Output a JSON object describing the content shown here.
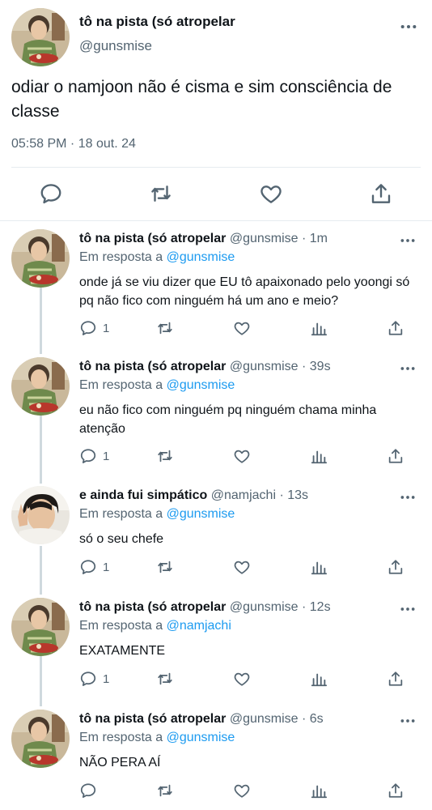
{
  "main_tweet": {
    "name": "tô na pista (só atropelar",
    "handle": "@gunsmise",
    "text": "odiar o namjoon não é cisma e sim consciência de classe",
    "time": "05:58 PM",
    "date": "18 out. 24"
  },
  "replies": [
    {
      "name": "tô na pista (só atropelar",
      "handle": "@gunsmise",
      "age": "1m",
      "reply_prefix": "Em resposta a",
      "reply_to": "@gunsmise",
      "text": "onde já se viu dizer que EU tô apaixonado pelo yoongi só pq não fico com ninguém há um ano e meio?",
      "reply_count": "1"
    },
    {
      "name": "tô na pista (só atropelar",
      "handle": "@gunsmise",
      "age": "39s",
      "reply_prefix": "Em resposta a",
      "reply_to": "@gunsmise",
      "text": "eu não fico com ninguém pq ninguém chama minha atenção",
      "reply_count": "1"
    },
    {
      "name": "e ainda fui simpático",
      "handle": "@namjachi",
      "age": "13s",
      "reply_prefix": "Em resposta a",
      "reply_to": "@gunsmise",
      "text": "só o seu chefe",
      "reply_count": "1"
    },
    {
      "name": "tô na pista (só atropelar",
      "handle": "@gunsmise",
      "age": "12s",
      "reply_prefix": "Em resposta a",
      "reply_to": "@namjachi",
      "text": "EXATAMENTE",
      "reply_count": "1"
    },
    {
      "name": "tô na pista (só atropelar",
      "handle": "@gunsmise",
      "age": "6s",
      "reply_prefix": "Em resposta a",
      "reply_to": "@gunsmise",
      "text": "NÃO PERA AÍ",
      "reply_count": ""
    }
  ],
  "icons": {
    "reply": "speech-bubble-icon",
    "retweet": "retweet-icon",
    "like": "heart-icon",
    "analytics": "bar-chart-icon",
    "share": "share-upload-icon",
    "more": "more-dots-icon"
  },
  "colors": {
    "text": "#0f1419",
    "secondary": "#536471",
    "link": "#1d9bf0",
    "divider": "#e6ecf0"
  }
}
